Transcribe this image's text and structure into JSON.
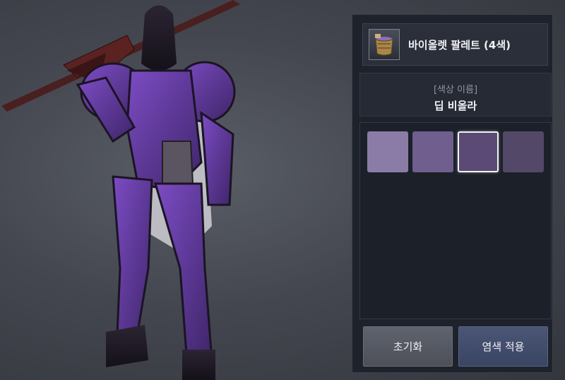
{
  "item": {
    "name": "바이올렛 팔레트 (4색)",
    "icon": "dye-bucket-icon"
  },
  "color_info": {
    "label": "[색상 이름]",
    "name": "딥 비올라"
  },
  "swatches": [
    {
      "color": "#8a7ca6",
      "selected": false
    },
    {
      "color": "#6f5e8e",
      "selected": false
    },
    {
      "color": "#5a4a75",
      "selected": true
    },
    {
      "color": "#544868",
      "selected": false
    }
  ],
  "buttons": {
    "reset_label": "초기화",
    "apply_label": "염색 적용"
  },
  "colors": {
    "armor_primary": "#6c3fb0",
    "armor_dark": "#2a1f38",
    "panel_bg": "#1e222b"
  }
}
